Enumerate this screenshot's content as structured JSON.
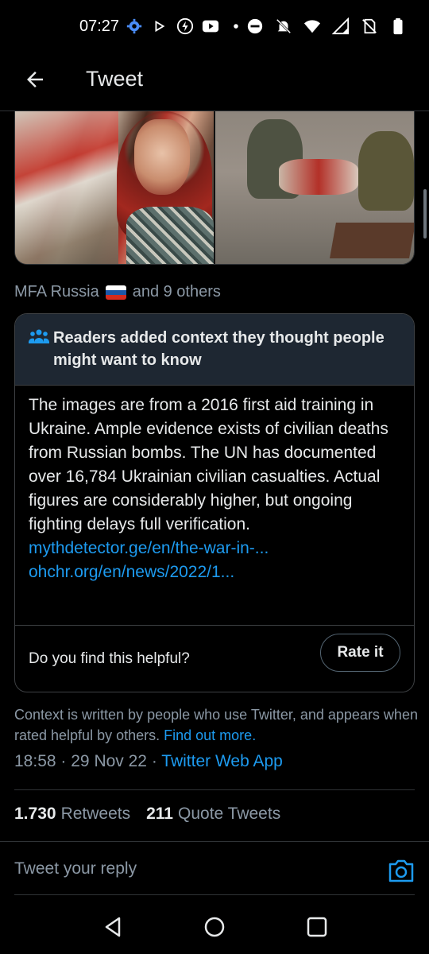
{
  "status_bar": {
    "time": "07:27"
  },
  "header": {
    "title": "Tweet"
  },
  "liked_by": {
    "account": "MFA Russia",
    "others": "and 9 others"
  },
  "context_note": {
    "title": "Readers added context they thought people might want to know",
    "body": "The images are from a 2016 first aid training in Ukraine. Ample evidence exists of civilian deaths from Russian bombs. The UN has documented over 16,784 Ukrainian civilian casualties. Actual figures are considerably higher, but ongoing fighting delays full verification.",
    "links": [
      "mythdetector.ge/en/the-war-in-...",
      "ohchr.org/en/news/2022/1..."
    ],
    "helpful_question": "Do you find this helpful?",
    "rate_button": "Rate it"
  },
  "context_info": {
    "text": "Context is written by people who use Twitter, and appears when rated helpful by others.",
    "find_out_more": "Find out more."
  },
  "timestamp": {
    "time": "18:58",
    "date": "29 Nov 22",
    "source": "Twitter Web App",
    "sep": "·"
  },
  "stats": {
    "retweets_count": "1.730",
    "retweets_label": "Retweets",
    "quotes_count": "211",
    "quotes_label": "Quote Tweets"
  },
  "reply": {
    "placeholder": "Tweet your reply"
  },
  "colors": {
    "accent": "#1d9bf0",
    "background": "#000000",
    "note_header": "#1e2732",
    "muted": "#8b98a5"
  },
  "icons": [
    "settings-icon",
    "play-icon",
    "data-saver-icon",
    "youtube-icon",
    "dnd-icon",
    "mute-icon",
    "wifi-icon",
    "signal-icon",
    "no-sim-icon",
    "battery-icon",
    "back-arrow-icon",
    "people-icon",
    "camera-icon",
    "nav-back-icon",
    "nav-home-icon",
    "nav-recents-icon"
  ]
}
